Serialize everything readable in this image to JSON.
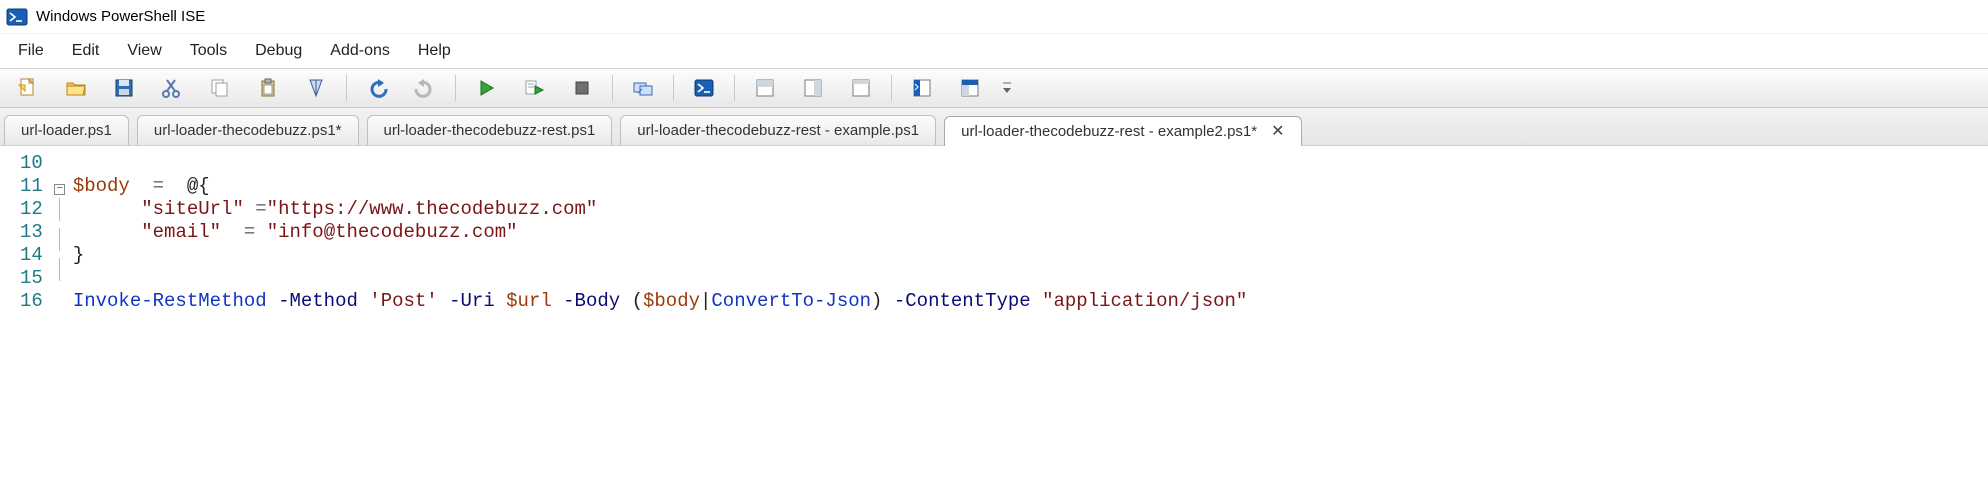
{
  "window": {
    "title": "Windows PowerShell ISE"
  },
  "menu": {
    "items": [
      "File",
      "Edit",
      "View",
      "Tools",
      "Debug",
      "Add-ons",
      "Help"
    ]
  },
  "toolbar": {
    "buttons": [
      {
        "name": "new-file-icon",
        "title": "New"
      },
      {
        "name": "open-folder-icon",
        "title": "Open"
      },
      {
        "name": "save-icon",
        "title": "Save"
      },
      {
        "name": "cut-icon",
        "title": "Cut"
      },
      {
        "name": "copy-icon",
        "title": "Copy"
      },
      {
        "name": "paste-icon",
        "title": "Paste"
      },
      {
        "name": "clear-icon",
        "title": "Clear"
      },
      {
        "sep": true
      },
      {
        "name": "undo-icon",
        "title": "Undo"
      },
      {
        "name": "redo-icon",
        "title": "Redo"
      },
      {
        "sep": true
      },
      {
        "name": "run-icon",
        "title": "Run Script"
      },
      {
        "name": "run-selection-icon",
        "title": "Run Selection"
      },
      {
        "name": "stop-icon",
        "title": "Stop"
      },
      {
        "sep": true
      },
      {
        "name": "remote-icon",
        "title": "New Remote Tab"
      },
      {
        "sep": true
      },
      {
        "name": "powershell-icon",
        "title": "Start PowerShell"
      },
      {
        "sep": true
      },
      {
        "name": "layout-script-top-icon",
        "title": "Show Script Pane Top"
      },
      {
        "name": "layout-script-right-icon",
        "title": "Show Script Pane Right"
      },
      {
        "name": "layout-script-max-icon",
        "title": "Show Script Pane Maximized"
      },
      {
        "sep": true
      },
      {
        "name": "show-command-icon",
        "title": "Show Command"
      },
      {
        "name": "show-command-addon-icon",
        "title": "Show Command Add-on"
      }
    ]
  },
  "tabs": [
    {
      "label": "url-loader.ps1",
      "active": false,
      "dirty": false
    },
    {
      "label": "url-loader-thecodebuzz.ps1*",
      "active": false,
      "dirty": true
    },
    {
      "label": "url-loader-thecodebuzz-rest.ps1",
      "active": false,
      "dirty": false
    },
    {
      "label": "url-loader-thecodebuzz-rest - example.ps1",
      "active": false,
      "dirty": false
    },
    {
      "label": "url-loader-thecodebuzz-rest - example2.ps1*",
      "active": true,
      "dirty": true
    }
  ],
  "editor": {
    "first_line_number": 10,
    "lines": [
      {
        "n": 10,
        "fold": "",
        "plain": ""
      },
      {
        "n": 11,
        "fold": "box",
        "tokens": [
          [
            "var",
            "$body"
          ],
          [
            "plain",
            "  "
          ],
          [
            "op",
            "="
          ],
          [
            "plain",
            "  "
          ],
          [
            "punc",
            "@{"
          ]
        ]
      },
      {
        "n": 12,
        "fold": "line",
        "tokens": [
          [
            "plain",
            "      "
          ],
          [
            "str",
            "\"siteUrl\""
          ],
          [
            "plain",
            " "
          ],
          [
            "op",
            "="
          ],
          [
            "str",
            "\"https://www.thecodebuzz.com\""
          ]
        ]
      },
      {
        "n": 13,
        "fold": "line",
        "tokens": [
          [
            "plain",
            "      "
          ],
          [
            "str",
            "\"email\""
          ],
          [
            "plain",
            "  "
          ],
          [
            "op",
            "="
          ],
          [
            "plain",
            " "
          ],
          [
            "str",
            "\"info@thecodebuzz.com\""
          ]
        ]
      },
      {
        "n": 14,
        "fold": "end",
        "tokens": [
          [
            "punc",
            "}"
          ]
        ]
      },
      {
        "n": 15,
        "fold": "",
        "plain": ""
      },
      {
        "n": 16,
        "fold": "",
        "tokens": [
          [
            "cmd",
            "Invoke-RestMethod"
          ],
          [
            "plain",
            " "
          ],
          [
            "param",
            "-Method"
          ],
          [
            "plain",
            " "
          ],
          [
            "str",
            "'Post'"
          ],
          [
            "plain",
            " "
          ],
          [
            "param",
            "-Uri"
          ],
          [
            "plain",
            " "
          ],
          [
            "var",
            "$url"
          ],
          [
            "plain",
            " "
          ],
          [
            "param",
            "-Body"
          ],
          [
            "plain",
            " "
          ],
          [
            "punc",
            "("
          ],
          [
            "var",
            "$body"
          ],
          [
            "punc",
            "|"
          ],
          [
            "cmd",
            "ConvertTo-Json"
          ],
          [
            "punc",
            ")"
          ],
          [
            "plain",
            " "
          ],
          [
            "param",
            "-ContentType"
          ],
          [
            "plain",
            " "
          ],
          [
            "str",
            "\"application/json\""
          ]
        ]
      }
    ]
  }
}
